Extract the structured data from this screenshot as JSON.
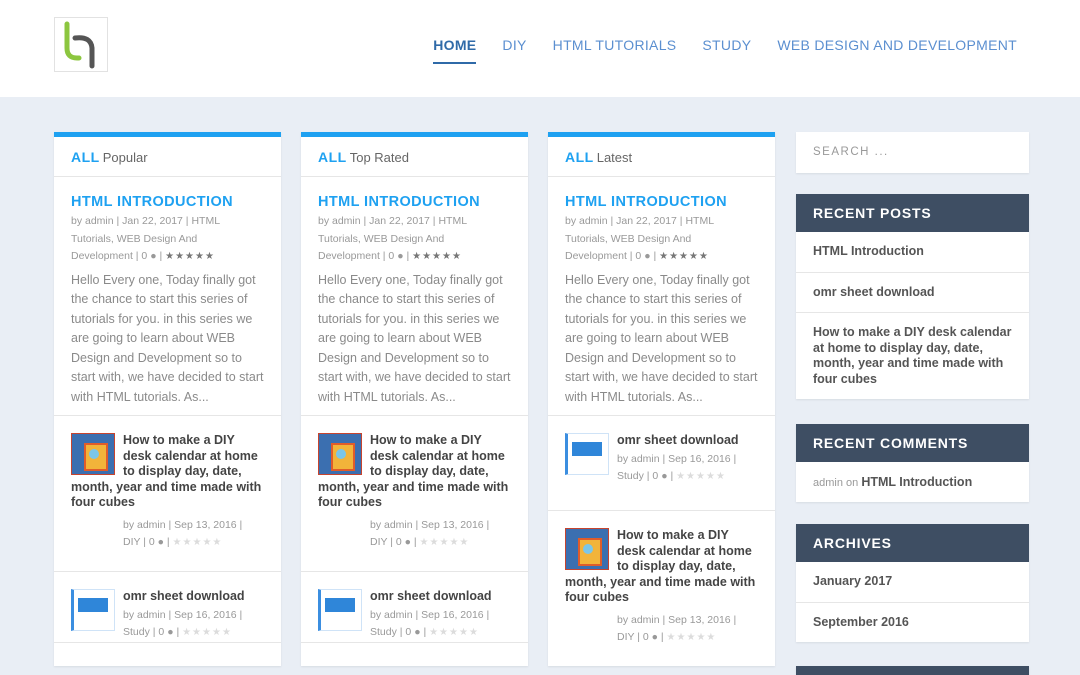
{
  "nav": [
    "HOME",
    "DIY",
    "HTML TUTORIALS",
    "STUDY",
    "WEB DESIGN AND DEVELOPMENT"
  ],
  "columns": [
    {
      "all": "ALL",
      "tab": "Popular",
      "main": {
        "title": "HTML INTRODUCTION",
        "meta_line1": "by admin | Jan 22, 2017 | HTML",
        "meta_line2": "Tutorials, WEB Design And",
        "meta_line3": "Development | 0",
        "stars": "★★★★★",
        "excerpt": "Hello Every one, Today finally got the chance to start this series of tutorials for you. in this series we are going to learn about WEB Design and Development so to start with, we have decided to start with HTML tutorials. As..."
      },
      "posts": [
        {
          "thumb": "cal",
          "title": "How to make a DIY desk calendar at home to display day, date, month, year and time made with four cubes",
          "meta1": "by admin | Sep 13, 2016 |",
          "meta2": "DIY | 0",
          "stars": "★★★★★"
        },
        {
          "thumb": "omr",
          "title": "omr sheet download",
          "meta1": "by admin | Sep 16, 2016 |",
          "meta2": "Study | 0",
          "stars": "★★★★★"
        }
      ]
    },
    {
      "all": "ALL",
      "tab": "Top Rated",
      "main": {
        "title": "HTML INTRODUCTION",
        "meta_line1": "by admin | Jan 22, 2017 | HTML",
        "meta_line2": "Tutorials, WEB Design And",
        "meta_line3": "Development | 0",
        "stars": "★★★★★",
        "excerpt": "Hello Every one, Today finally got the chance to start this series of tutorials for you. in this series we are going to learn about WEB Design and Development so to start with, we have decided to start with HTML tutorials. As..."
      },
      "posts": [
        {
          "thumb": "cal",
          "title": "How to make a DIY desk calendar at home to display day, date, month, year and time made with four cubes",
          "meta1": "by admin | Sep 13, 2016 |",
          "meta2": "DIY | 0",
          "stars": "★★★★★"
        },
        {
          "thumb": "omr",
          "title": "omr sheet download",
          "meta1": "by admin | Sep 16, 2016 |",
          "meta2": "Study | 0",
          "stars": "★★★★★"
        }
      ]
    },
    {
      "all": "ALL",
      "tab": "Latest",
      "main": {
        "title": "HTML INTRODUCTION",
        "meta_line1": "by admin | Jan 22, 2017 | HTML",
        "meta_line2": "Tutorials, WEB Design And",
        "meta_line3": "Development | 0",
        "stars": "★★★★★",
        "excerpt": "Hello Every one, Today finally got the chance to start this series of tutorials for you. in this series we are going to learn about WEB Design and Development so to start with, we have decided to start with HTML tutorials. As..."
      },
      "posts": [
        {
          "thumb": "omr",
          "title": "omr sheet download",
          "meta1": "by admin | Sep 16, 2016 |",
          "meta2": "Study | 0",
          "stars": "★★★★★"
        },
        {
          "thumb": "cal",
          "title": "How to make a DIY desk calendar at home to display day, date, month, year and time made with four cubes",
          "meta1": "by admin | Sep 13, 2016 |",
          "meta2": "DIY | 0",
          "stars": "★★★★★"
        }
      ]
    }
  ],
  "sidebar": {
    "search_placeholder": "SEARCH ...",
    "recent_posts": {
      "title": "RECENT POSTS",
      "items": [
        "HTML Introduction",
        "omr sheet download",
        "How to make a DIY desk calendar at home to display day, date, month, year and time made with four cubes"
      ]
    },
    "recent_comments": {
      "title": "RECENT COMMENTS",
      "author": "admin",
      "on": "on",
      "post": "HTML Introduction"
    },
    "archives": {
      "title": "ARCHIVES",
      "items": [
        "January 2017",
        "September 2016"
      ]
    }
  },
  "colors": {
    "accent": "#1ea1f1",
    "sidebar_header": "#3e4e63",
    "nav": "#5b8fd0"
  }
}
